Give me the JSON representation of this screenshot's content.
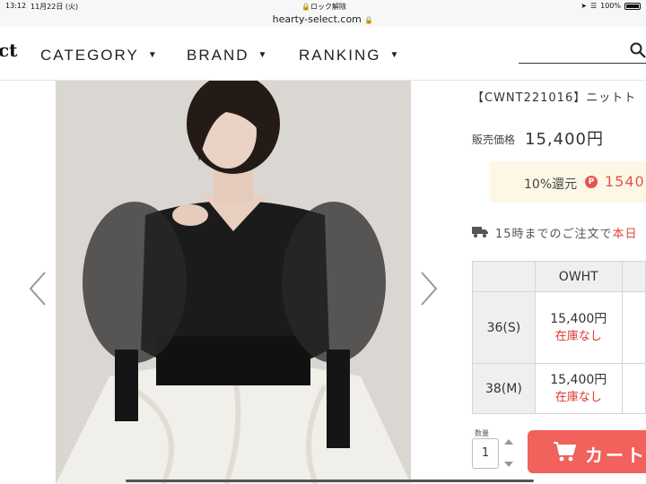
{
  "status_bar": {
    "time": "13:12",
    "date": "11月22日 (火)",
    "lock_text": "ロック解除",
    "url": "hearty-select.com",
    "battery": "100%"
  },
  "nav": {
    "logo_text": "ct",
    "items": [
      "CATEGORY",
      "BRAND",
      "RANKING"
    ]
  },
  "product": {
    "code": "【CWNT221016】ニットト",
    "price_label": "販売価格",
    "price": "15,400円",
    "points_rate": "10%還元",
    "points_badge": "P",
    "points_value": "1540",
    "shipping_text": "15時までのご注文で",
    "shipping_highlight": "本日"
  },
  "stock_table": {
    "color_header": "OWHT",
    "rows": [
      {
        "size": "36(S)",
        "price": "15,400円",
        "status": "在庫なし"
      },
      {
        "size": "38(M)",
        "price": "15,400円",
        "status": "在庫なし"
      }
    ]
  },
  "purchase": {
    "qty_label": "数量",
    "qty_value": "1",
    "cart_label": "カート"
  },
  "colors": {
    "accent": "#f0625b",
    "points_bg": "#fdf7e6",
    "out_of_stock": "#e0352b"
  }
}
